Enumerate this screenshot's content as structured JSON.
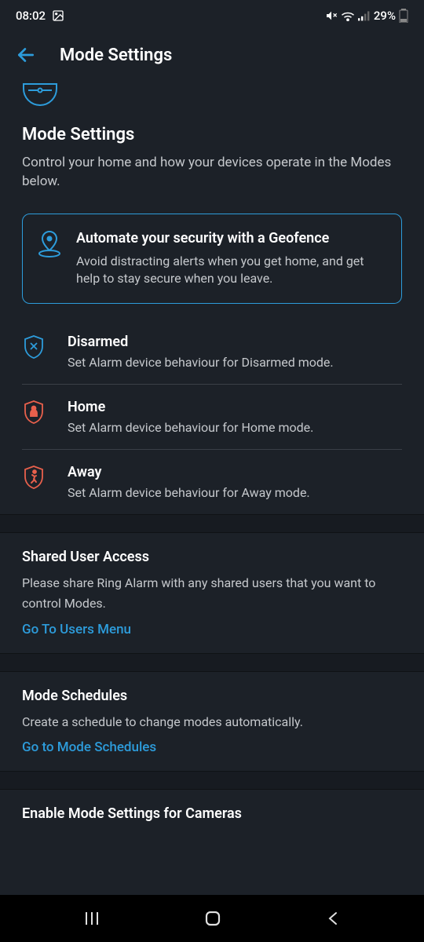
{
  "statusBar": {
    "time": "08:02",
    "battery": "29%"
  },
  "header": {
    "title": "Mode Settings"
  },
  "page": {
    "title": "Mode Settings",
    "subtitle": "Control your home and how your devices operate in the Modes below."
  },
  "geofence": {
    "title": "Automate your security with a Geofence",
    "desc": "Avoid distracting alerts when you get home, and get help to stay secure when you leave."
  },
  "modes": [
    {
      "title": "Disarmed",
      "desc": "Set Alarm device behaviour for Disarmed mode."
    },
    {
      "title": "Home",
      "desc": "Set Alarm device behaviour for Home mode."
    },
    {
      "title": "Away",
      "desc": "Set Alarm device behaviour for Away mode."
    }
  ],
  "sharedUser": {
    "title": "Shared User Access",
    "desc": "Please share Ring Alarm with any shared users that you want to control Modes.",
    "link": "Go To Users Menu"
  },
  "schedules": {
    "title": "Mode Schedules",
    "desc": "Create a schedule to change modes automatically.",
    "link": "Go to Mode Schedules"
  },
  "cameras": {
    "title": "Enable Mode Settings for Cameras"
  }
}
